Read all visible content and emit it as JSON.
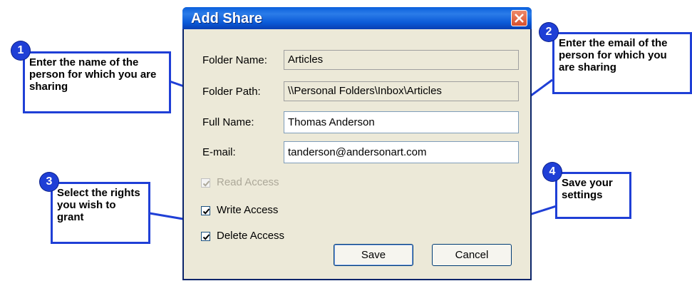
{
  "dialog": {
    "title": "Add Share",
    "folder_name_label": "Folder Name:",
    "folder_name_value": "Articles",
    "folder_path_label": "Folder Path:",
    "folder_path_value": "\\\\Personal Folders\\Inbox\\Articles",
    "full_name_label": "Full Name:",
    "full_name_value": "Thomas Anderson",
    "email_label": "E-mail:",
    "email_value": "tanderson@andersonart.com",
    "read_access_label": "Read Access",
    "write_access_label": "Write Access",
    "delete_access_label": "Delete Access",
    "save_label": "Save",
    "cancel_label": "Cancel"
  },
  "callouts": [
    {
      "number": "1",
      "text": "Enter the name of the person for which you are sharing"
    },
    {
      "number": "2",
      "text": "Enter the email of the person for which you are sharing"
    },
    {
      "number": "3",
      "text": "Select the rights you wish to grant"
    },
    {
      "number": "4",
      "text": "Save your settings"
    }
  ],
  "colors": {
    "callout_blue": "#1f3fd6",
    "titlebar_blue": "#0a5fdc",
    "dialog_bg": "#ece9d8"
  }
}
